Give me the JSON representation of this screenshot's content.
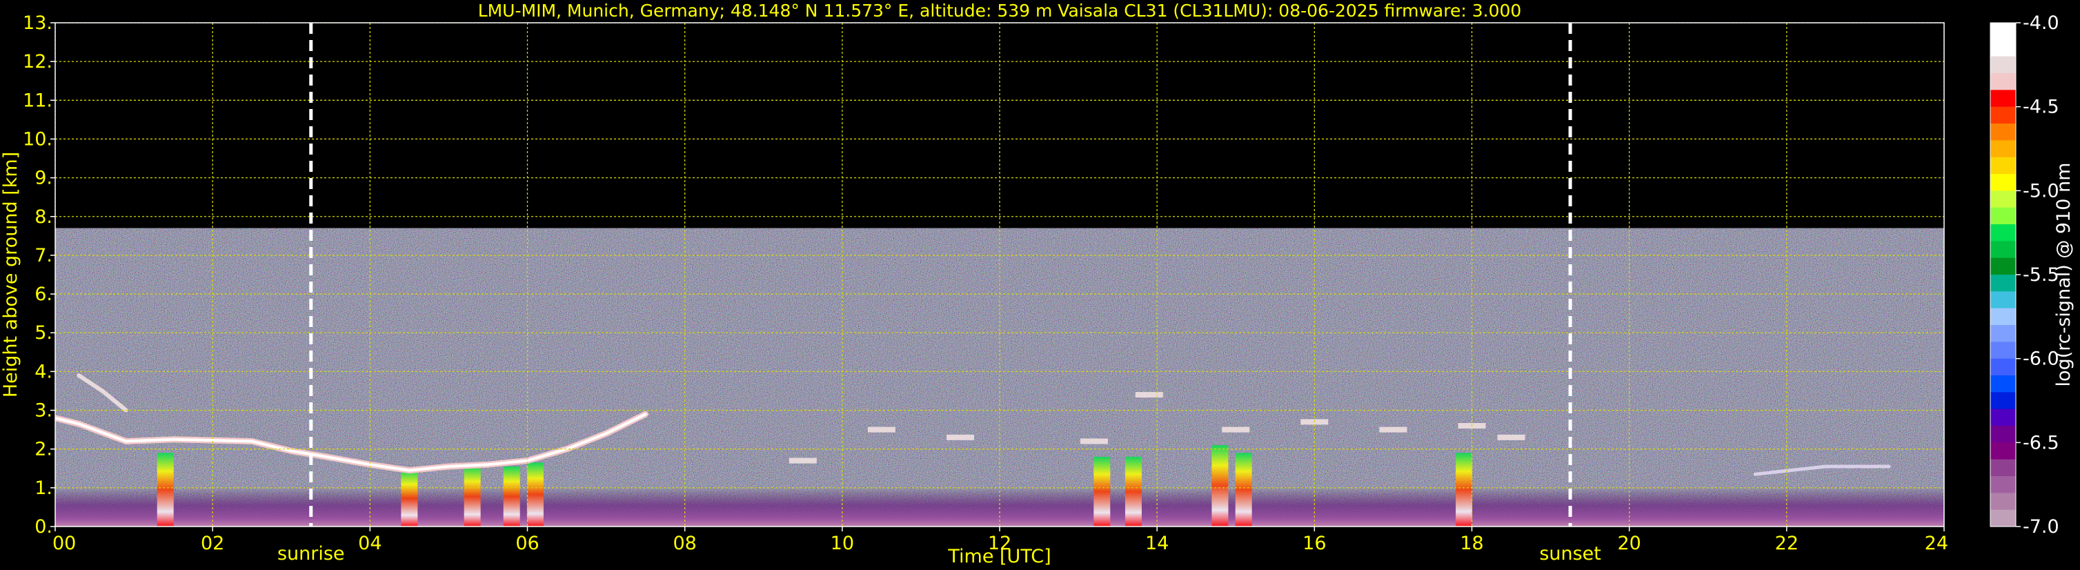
{
  "chart_data": {
    "type": "heatmap",
    "title": "LMU-MIM, Munich, Germany; 48.148° N 11.573° E, altitude: 539 m    Vaisala CL31 (CL31LMU): 08-06-2025    firmware: 3.000",
    "xlabel": "Time [UTC]",
    "ylabel": "Height above ground [km]",
    "xlim": [
      0,
      24
    ],
    "ylim": [
      0,
      13
    ],
    "x_ticks": [
      0,
      2,
      4,
      6,
      8,
      10,
      12,
      14,
      16,
      18,
      20,
      22,
      24
    ],
    "x_tick_labels": [
      "00",
      "02",
      "04",
      "06",
      "08",
      "10",
      "12",
      "14",
      "16",
      "18",
      "20",
      "22",
      "24"
    ],
    "y_ticks": [
      0,
      1,
      2,
      3,
      4,
      5,
      6,
      7,
      8,
      9,
      10,
      11,
      12,
      13
    ],
    "y_tick_labels": [
      "0.",
      "1.",
      "2.",
      "3.",
      "4.",
      "5.",
      "6.",
      "7.",
      "8.",
      "9.",
      "10.",
      "11.",
      "12.",
      "13."
    ],
    "grid": true,
    "data_top_km": 7.7,
    "markers": [
      {
        "name": "sunrise",
        "time": 3.25
      },
      {
        "name": "sunset",
        "time": 19.25
      }
    ],
    "colorbar": {
      "label": "log(rc-signal) @ 910 nm",
      "range": [
        -7.0,
        -4.0
      ],
      "tick_values": [
        -4.0,
        -4.5,
        -5.0,
        -5.5,
        -6.0,
        -6.5,
        -7.0
      ],
      "tick_labels": [
        "-4.0",
        "-4.5",
        "-5.0",
        "-5.5",
        "-6.0",
        "-6.5",
        "-7.0"
      ],
      "colors": [
        "#ffffff",
        "#ffffff",
        "#e8dadb",
        "#f2c8c8",
        "#ff0000",
        "#ff3b00",
        "#ff8000",
        "#ffb000",
        "#ffd700",
        "#ffff00",
        "#c8ff3c",
        "#8cff3c",
        "#00e050",
        "#00c040",
        "#009020",
        "#00b090",
        "#40c0e0",
        "#a0c8ff",
        "#80a0ff",
        "#6080ff",
        "#4060ff",
        "#0050ff",
        "#0020e0",
        "#5000c0",
        "#700090",
        "#800080",
        "#904090",
        "#a060a0",
        "#b080a8",
        "#c0a0b8"
      ]
    },
    "features": {
      "boundary_layer_top": [
        [
          0.0,
          2.8
        ],
        [
          0.3,
          2.65
        ],
        [
          0.9,
          2.2
        ],
        [
          1.5,
          2.25
        ],
        [
          2.5,
          2.2
        ],
        [
          3.0,
          1.95
        ],
        [
          3.3,
          1.85
        ],
        [
          4.0,
          1.6
        ],
        [
          4.5,
          1.45
        ],
        [
          5.0,
          1.55
        ],
        [
          5.5,
          1.6
        ],
        [
          6.0,
          1.7
        ],
        [
          6.5,
          2.0
        ],
        [
          7.0,
          2.4
        ],
        [
          7.5,
          2.9
        ]
      ],
      "residual_layer": [
        [
          0.3,
          3.9
        ],
        [
          0.6,
          3.5
        ],
        [
          0.9,
          3.0
        ]
      ],
      "cloud_tops_afternoon": [
        [
          9.5,
          1.7
        ],
        [
          10.5,
          2.5
        ],
        [
          11.5,
          2.3
        ],
        [
          13.2,
          2.2
        ],
        [
          13.9,
          3.4
        ],
        [
          15.0,
          2.5
        ],
        [
          16.0,
          2.7
        ],
        [
          17.0,
          2.5
        ],
        [
          18.0,
          2.6
        ],
        [
          18.5,
          2.3
        ]
      ],
      "evening_layer": [
        [
          21.6,
          1.35
        ],
        [
          22.5,
          1.55
        ],
        [
          23.3,
          1.55
        ]
      ],
      "strong_signal_columns": [
        [
          1.4,
          1.9
        ],
        [
          4.5,
          1.45
        ],
        [
          5.3,
          1.55
        ],
        [
          5.8,
          1.55
        ],
        [
          6.1,
          1.65
        ],
        [
          13.3,
          1.8
        ],
        [
          13.7,
          1.8
        ],
        [
          14.8,
          2.1
        ],
        [
          15.1,
          1.9
        ],
        [
          17.9,
          1.9
        ]
      ]
    }
  }
}
